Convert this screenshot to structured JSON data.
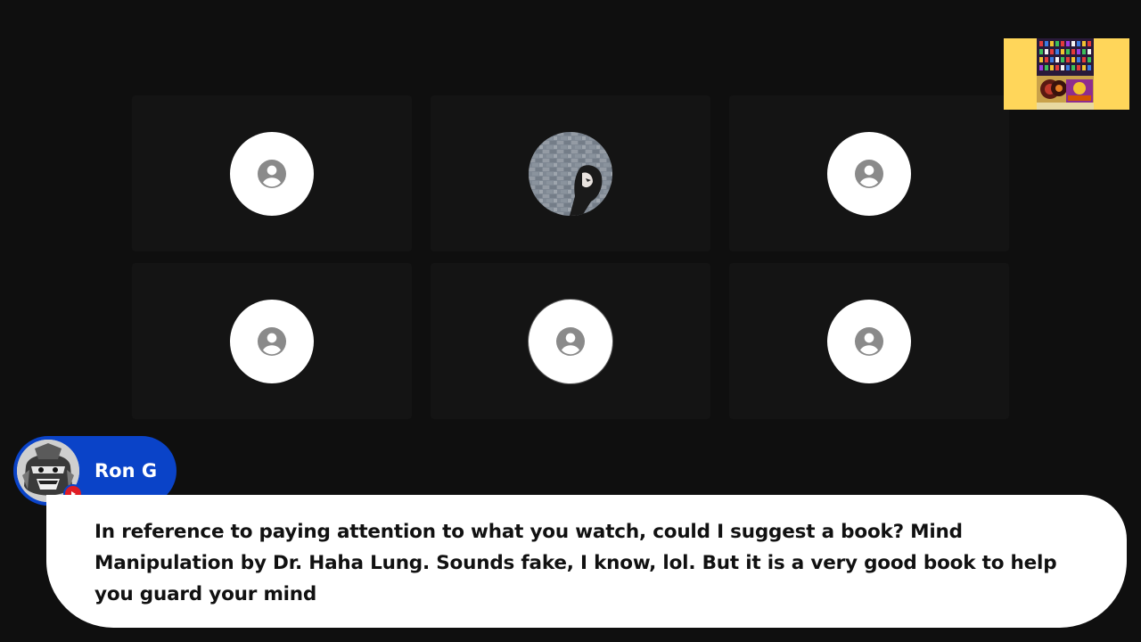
{
  "participants": [
    {
      "type": "placeholder",
      "icon": "account-circle-icon"
    },
    {
      "type": "photo",
      "icon": "participant-photo"
    },
    {
      "type": "placeholder",
      "icon": "account-circle-icon"
    },
    {
      "type": "placeholder",
      "icon": "account-circle-icon"
    },
    {
      "type": "placeholder",
      "icon": "account-circle-icon",
      "highlighted": true
    },
    {
      "type": "placeholder",
      "icon": "account-circle-icon"
    }
  ],
  "chat": {
    "author_name": "Ron G",
    "platform_badge": "youtube-icon",
    "message": "In reference to paying attention to what you watch, could I suggest a book? Mind Manipulation by Dr. Haha Lung. Sounds fake, I know, lol. But it is a very good book to help you guard your mind"
  },
  "colors": {
    "background": "#0f0f0f",
    "tile": "#141414",
    "author_pill": "#0a43c8",
    "youtube_red": "#e01c24",
    "logo_yellow": "#ffd65a"
  }
}
